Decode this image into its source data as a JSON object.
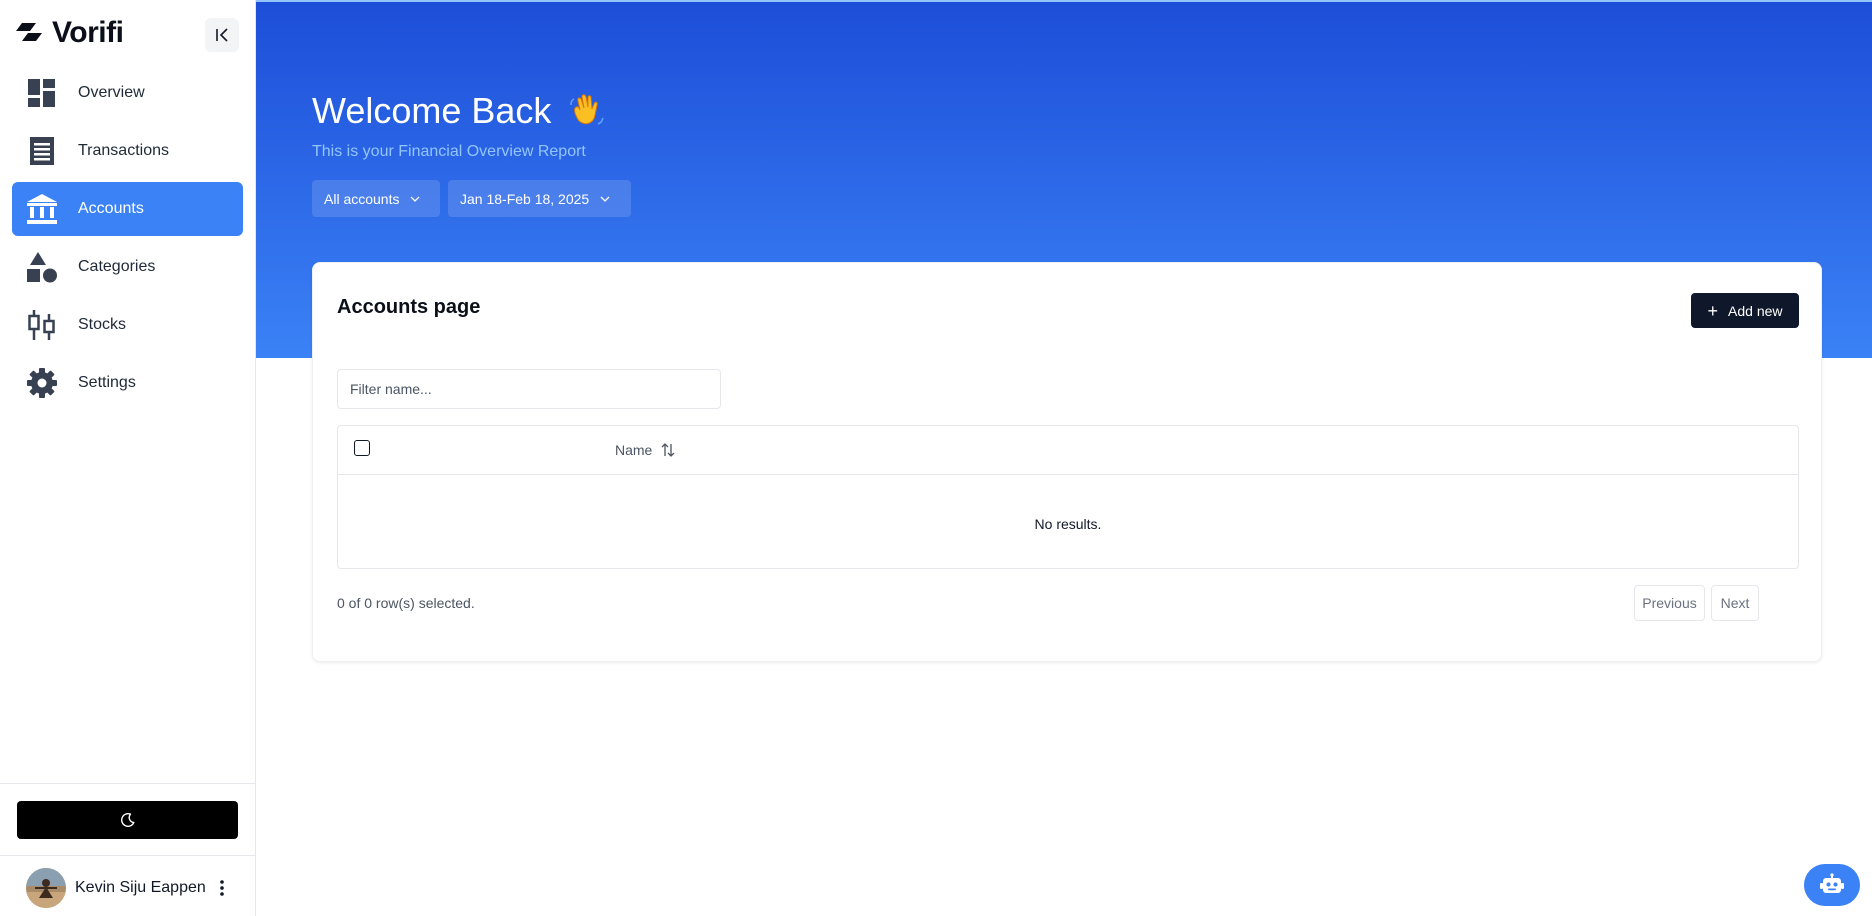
{
  "app": {
    "name": "Vorifi"
  },
  "sidebar": {
    "items": [
      {
        "label": "Overview",
        "icon": "dashboard-icon",
        "active": false
      },
      {
        "label": "Transactions",
        "icon": "receipt-icon",
        "active": false
      },
      {
        "label": "Accounts",
        "icon": "bank-icon",
        "active": true
      },
      {
        "label": "Categories",
        "icon": "shapes-icon",
        "active": false
      },
      {
        "label": "Stocks",
        "icon": "candlestick-icon",
        "active": false
      },
      {
        "label": "Settings",
        "icon": "gear-icon",
        "active": false
      }
    ],
    "theme_toggle_icon": "moon-icon",
    "user": {
      "name": "Kevin Siju Eappen"
    }
  },
  "hero": {
    "title": "Welcome Back",
    "emoji": "waving-hand-icon",
    "subtitle": "This is your Financial Overview Report",
    "account_filter": "All accounts",
    "date_filter": "Jan 18-Feb 18, 2025"
  },
  "card": {
    "title": "Accounts page",
    "add_label": "Add new",
    "filter_placeholder": "Filter name...",
    "columns": [
      "Name"
    ],
    "rows": [],
    "empty_text": "No results.",
    "selection_text": "0 of 0 row(s) selected.",
    "prev_label": "Previous",
    "next_label": "Next"
  },
  "colors": {
    "accent": "#3b82f6",
    "hero_top": "#1d4ed8",
    "button_dark": "#0f172a"
  }
}
